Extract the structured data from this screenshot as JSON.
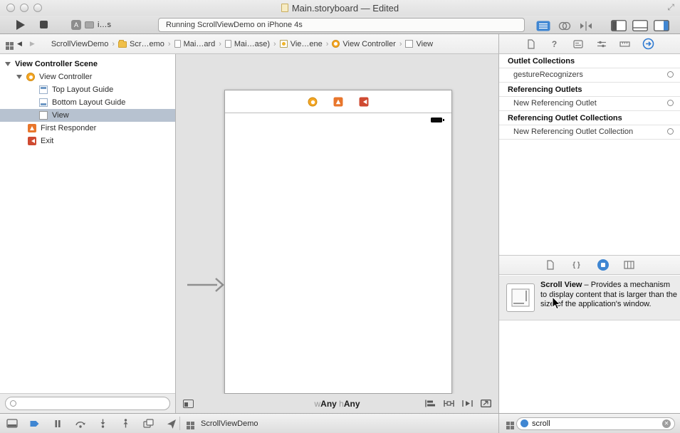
{
  "colors": {
    "accent_blue": "#3f86d2",
    "selection": "#b7c2d0",
    "canvas_bg": "#e2e2e2"
  },
  "glyphs": {
    "chevron": "›",
    "back": "◀",
    "forward": "▶",
    "question": "?",
    "braces": "{ }",
    "clear": "✕",
    "expand": "⤢",
    "scheme_letter": "A"
  },
  "titlebar": {
    "title": "Main.storyboard — Edited"
  },
  "toolbar": {
    "scheme_label": "i…s",
    "activity_text": "Running ScrollViewDemo on iPhone 4s"
  },
  "jumpbar": {
    "items": [
      {
        "label": "ScrollViewDemo"
      },
      {
        "label": "Scr…emo"
      },
      {
        "label": "Mai…ard"
      },
      {
        "label": "Mai…ase)"
      },
      {
        "label": "Vie…ene"
      },
      {
        "label": "View Controller"
      },
      {
        "label": "View"
      }
    ]
  },
  "outline": {
    "rows": [
      {
        "label": "View Controller Scene"
      },
      {
        "label": "View Controller"
      },
      {
        "label": "Top Layout Guide"
      },
      {
        "label": "Bottom Layout Guide"
      },
      {
        "label": "View"
      },
      {
        "label": "First Responder"
      },
      {
        "label": "Exit"
      }
    ]
  },
  "canvas": {
    "size_class": {
      "w_key": "w",
      "w_value": "Any",
      "h_key": "h",
      "h_value": "Any"
    }
  },
  "inspector": {
    "sections": [
      {
        "header": "Outlet Collections",
        "row": "gestureRecognizers"
      },
      {
        "header": "Referencing Outlets",
        "row": "New Referencing Outlet"
      },
      {
        "header": "Referencing Outlet Collections",
        "row": "New Referencing Outlet Collection"
      }
    ]
  },
  "library": {
    "result": {
      "title": "Scroll View",
      "description": " – Provides a mechanism to display content that is larger than the size of the application's window."
    },
    "search_value": "scroll"
  },
  "debugbar": {
    "process_name": "ScrollViewDemo"
  }
}
